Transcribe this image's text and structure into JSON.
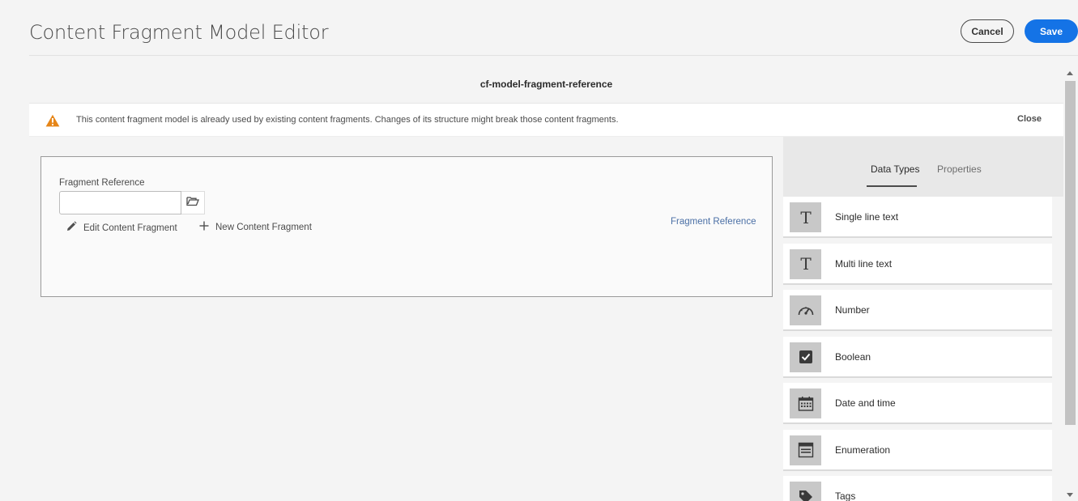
{
  "header": {
    "title": "Content Fragment Model Editor",
    "cancel_label": "Cancel",
    "save_label": "Save"
  },
  "model": {
    "name": "cf-model-fragment-reference"
  },
  "banner": {
    "message": "This content fragment model is already used by existing content fragments. Changes of its structure might break those content fragments.",
    "close_label": "Close"
  },
  "field": {
    "label": "Fragment Reference",
    "value": "",
    "edit_label": "Edit Content Fragment",
    "new_label": "New Content Fragment",
    "type_tag": "Fragment Reference"
  },
  "panel": {
    "tabs": [
      {
        "label": "Data Types",
        "active": true
      },
      {
        "label": "Properties",
        "active": false
      }
    ],
    "data_types": [
      {
        "label": "Single line text",
        "icon": "text-icon"
      },
      {
        "label": "Multi line text",
        "icon": "text-icon"
      },
      {
        "label": "Number",
        "icon": "gauge-icon"
      },
      {
        "label": "Boolean",
        "icon": "checkbox-icon"
      },
      {
        "label": "Date and time",
        "icon": "calendar-icon"
      },
      {
        "label": "Enumeration",
        "icon": "list-icon"
      },
      {
        "label": "Tags",
        "icon": "tag-icon"
      }
    ]
  },
  "colors": {
    "accent": "#1473e6",
    "warning": "#e68619",
    "link": "#4a6fa5"
  }
}
